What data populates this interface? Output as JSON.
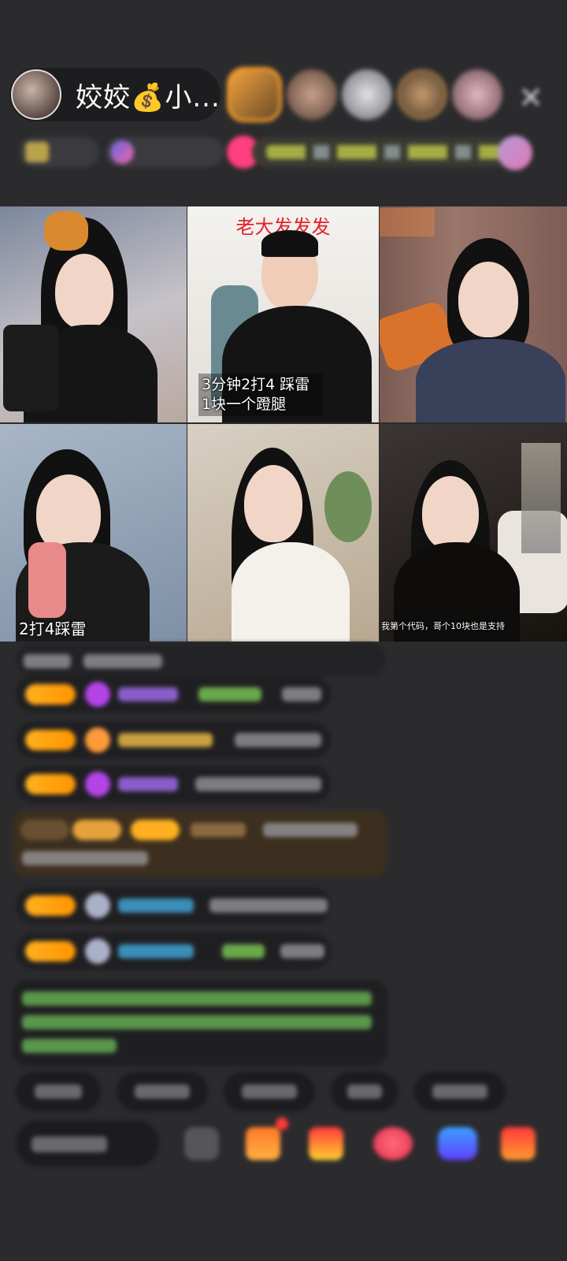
{
  "header": {
    "host_name": "姣姣💰小...",
    "close_icon": "close-icon"
  },
  "video_grid": {
    "tile2_title": "老大发发发",
    "tile2_note": "3分钟2打4 踩雷 1块一个蹬腿",
    "tile4_note": "2打4踩雷",
    "tile6_note": "我第个代码，哥个10块也是支持"
  },
  "colors": {
    "background": "#2b2b2e",
    "level_badge": "#ffb020",
    "highlight_message": "#3c2f1f"
  }
}
